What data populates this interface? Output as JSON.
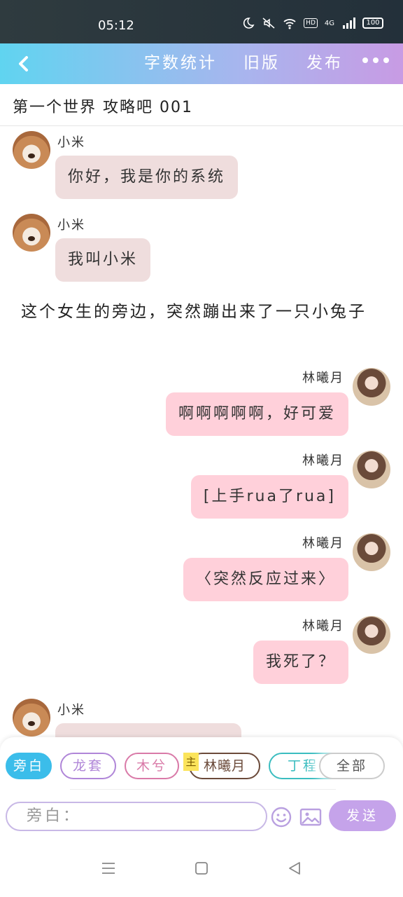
{
  "status": {
    "time": "05:12",
    "network": "4G",
    "battery": "100"
  },
  "header": {
    "menu": [
      "字数统计",
      "旧版",
      "发布"
    ]
  },
  "title": "第一个世界  攻略吧 001",
  "messages": [
    {
      "sender": "小米",
      "text": "你好，我是你的系统",
      "side": "left",
      "avatar": "puppy-avatar"
    },
    {
      "sender": "小米",
      "text": "我叫小米",
      "side": "left",
      "avatar": "puppy-avatar"
    },
    {
      "narration": "这个女生的旁边，突然蹦出来了一只小兔子"
    },
    {
      "sender": "林曦月",
      "text": "啊啊啊啊啊，好可爱",
      "side": "right",
      "avatar": "girl-avatar"
    },
    {
      "sender": "林曦月",
      "text": "[上手rua了rua]",
      "side": "right",
      "avatar": "girl-avatar"
    },
    {
      "sender": "林曦月",
      "text": "〈突然反应过来〉",
      "side": "right",
      "avatar": "girl-avatar"
    },
    {
      "sender": "林曦月",
      "text": "我死了？",
      "side": "right",
      "avatar": "girl-avatar"
    },
    {
      "sender": "小米",
      "text": "",
      "side": "left",
      "avatar": "puppy-avatar"
    }
  ],
  "roles": [
    {
      "label": "旁白",
      "color": "#3bbdea",
      "active": true
    },
    {
      "label": "龙套",
      "color": "#b086d8"
    },
    {
      "label": "木兮",
      "color": "#d97aa8"
    },
    {
      "label": "林曦月",
      "color": "#6b4a3a",
      "tag": "主"
    },
    {
      "label": "丁程鑫",
      "color": "#3bbdc0"
    },
    {
      "label": "全部",
      "color": "#bbbbbb"
    }
  ],
  "input": {
    "placeholder": "旁白："
  },
  "send_label": "发送"
}
